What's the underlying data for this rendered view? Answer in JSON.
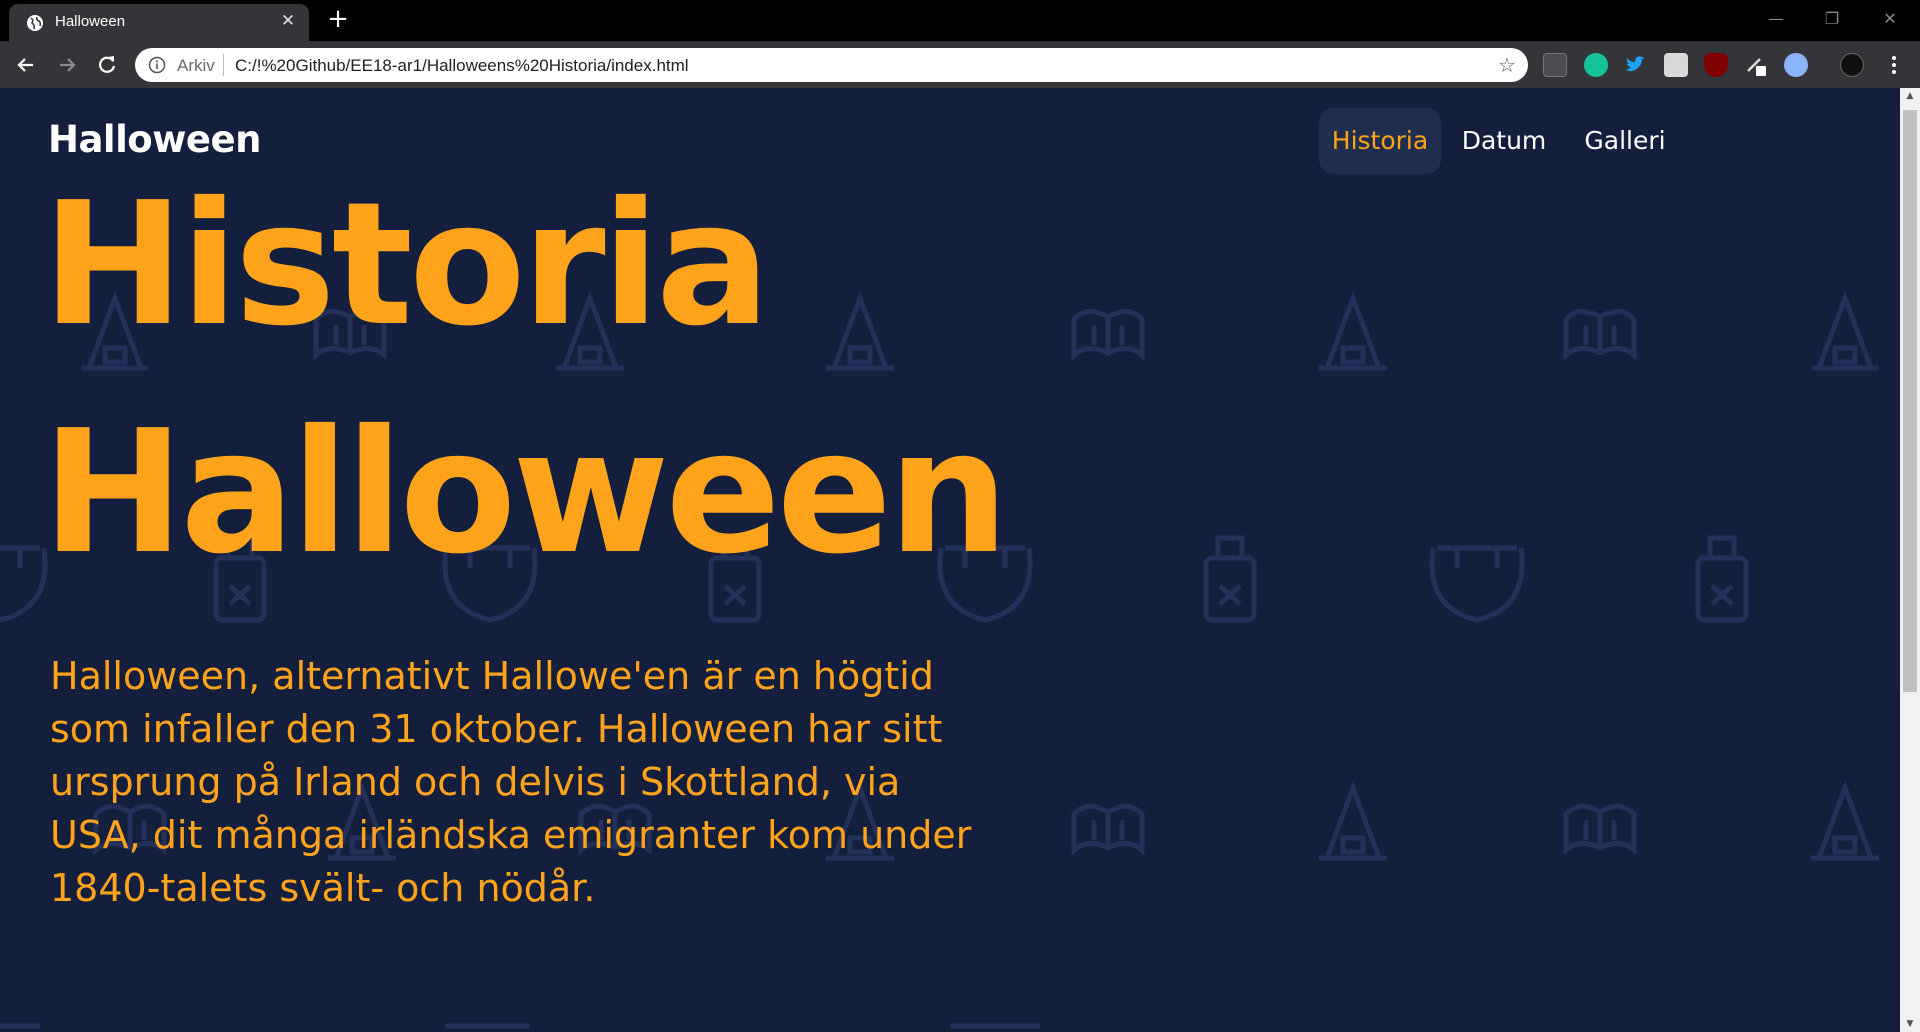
{
  "browser": {
    "tab_title": "Halloween",
    "tab_close": "✕",
    "new_tab": "+",
    "url_scheme": "Arkiv",
    "url": "C:/!%20Github/EE18-ar1/Halloweens%20Historia/index.html",
    "star": "☆",
    "window_minimize": "—",
    "window_restore": "❐",
    "window_close": "✕"
  },
  "site": {
    "brand": "Halloween",
    "nav": [
      {
        "label": "Historia",
        "active": true
      },
      {
        "label": "Datum",
        "active": false
      },
      {
        "label": "Galleri",
        "active": false
      }
    ]
  },
  "hero": {
    "title_line1": "Historia",
    "title_line2": "Halloween",
    "intro": "Halloween, alternativt Hallowe'en är en högtid som infaller den 31 oktober. Halloween har sitt ursprung på Irland och delvis i Skottland, via USA, dit många irländska emigranter kom under 1840-talets svält- och nödår."
  },
  "colors": {
    "background": "#141f3d",
    "accent": "#ffa31a",
    "nav_active_bg": "#1f2d4f",
    "pattern": "#22305a"
  }
}
